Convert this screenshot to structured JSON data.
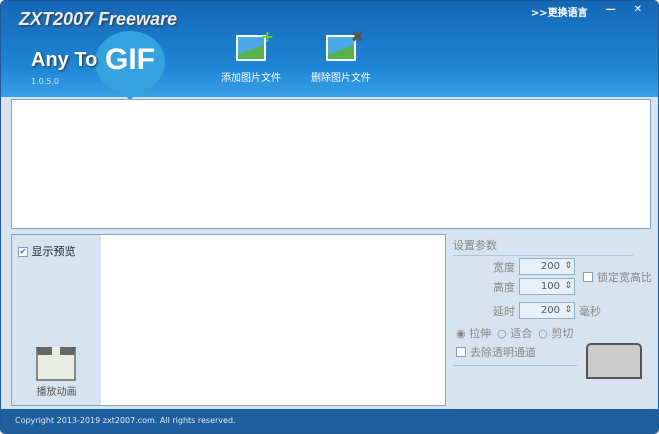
{
  "header": {
    "brand": "ZXT2007 Freeware",
    "any_to": "Any To",
    "gif": "GIF",
    "version": "1.0.5.0",
    "change_language": ">>更换语言",
    "minimize": "—",
    "close": "✕"
  },
  "toolbar": {
    "add_label": "添加图片文件",
    "remove_label": "删除图片文件"
  },
  "preview": {
    "show_preview": "显示预览",
    "play_animation": "播放动画"
  },
  "settings": {
    "title": "设置参数",
    "width_label": "宽度",
    "width_value": "200",
    "height_label": "高度",
    "height_value": "100",
    "lock_ratio": "锁定宽高比",
    "delay_label": "延时",
    "delay_value": "200",
    "delay_unit": "毫秒",
    "mode_stretch": "拉伸",
    "mode_fit": "适合",
    "mode_crop": "剪切",
    "remove_alpha": "去除透明通道"
  },
  "footer": {
    "copyright": "Copyright 2013-2019 zxt2007.com. All rights reserved."
  }
}
